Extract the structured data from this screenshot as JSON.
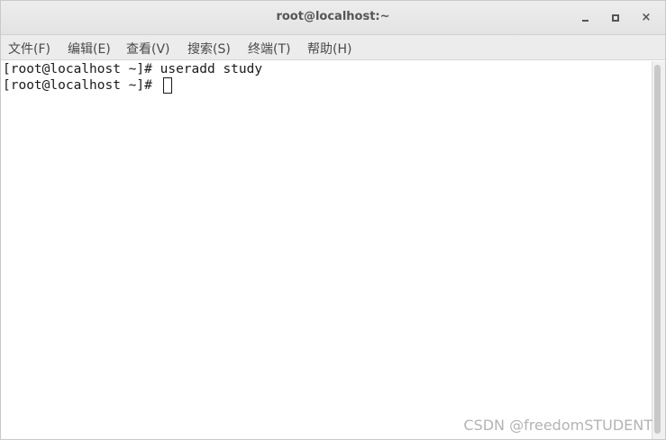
{
  "window": {
    "title": "root@localhost:~",
    "controls": {
      "minimize": "minimize-icon",
      "maximize": "maximize-icon",
      "close": "×"
    }
  },
  "menubar": {
    "items": [
      {
        "label": "文件(F)"
      },
      {
        "label": "编辑(E)"
      },
      {
        "label": "查看(V)"
      },
      {
        "label": "搜索(S)"
      },
      {
        "label": "终端(T)"
      },
      {
        "label": "帮助(H)"
      }
    ]
  },
  "terminal": {
    "lines": [
      {
        "prompt": "[root@localhost ~]# ",
        "command": "useradd study"
      },
      {
        "prompt": "[root@localhost ~]# ",
        "command": ""
      }
    ]
  },
  "watermark": {
    "text": "CSDN @freedomSTUDENT"
  },
  "colors": {
    "titlebar": "#e6e6e6",
    "menubar": "#ececec",
    "terminal_bg": "#ffffff",
    "terminal_fg": "#1a1a1a"
  }
}
